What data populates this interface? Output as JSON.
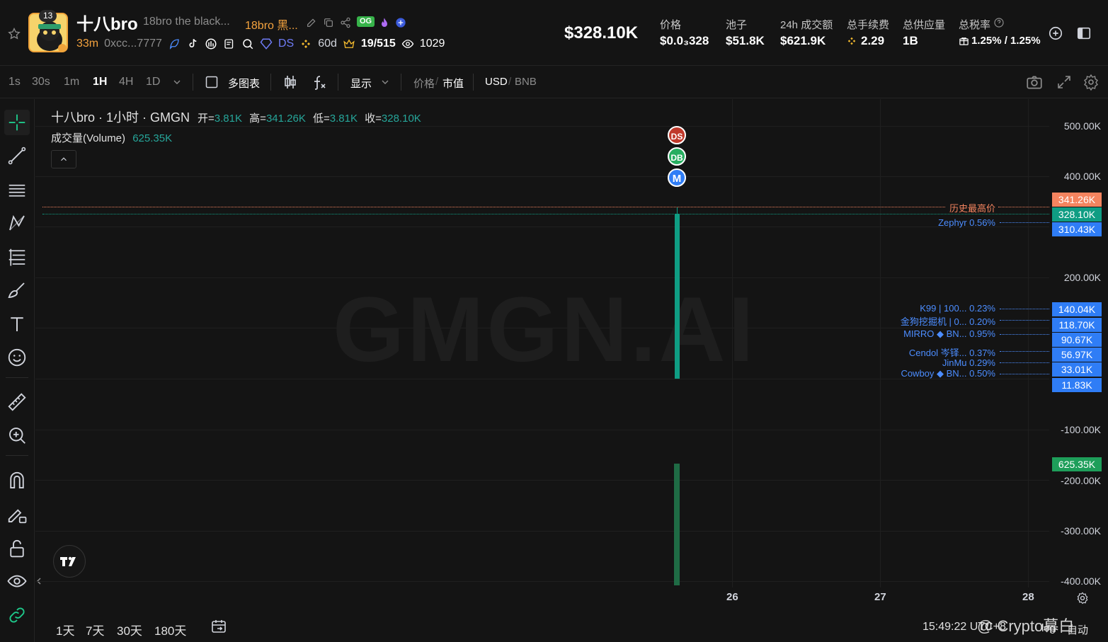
{
  "header": {
    "token_name": "十八bro",
    "token_full": "18bro the black...",
    "token_cn": "18bro 黑...",
    "avatar_badge": "13",
    "og_label": "OG",
    "age": "33m",
    "address": "0xcc...7777",
    "ds_label": "DS",
    "days": "60d",
    "holders": "19/515",
    "views": "1029",
    "market_cap": "$328.10K",
    "stats": [
      {
        "label": "价格",
        "value": "$0.0₃328"
      },
      {
        "label": "池子",
        "value": "$51.8K"
      },
      {
        "label": "24h 成交额",
        "value": "$621.9K"
      },
      {
        "label": "总手续费",
        "value": "2.29"
      },
      {
        "label": "总供应量",
        "value": "1B"
      },
      {
        "label": "总税率",
        "value": "1.25% / 1.25%"
      }
    ]
  },
  "toolbar": {
    "timeframes": [
      "1s",
      "30s",
      "1m",
      "1H",
      "4H",
      "1D"
    ],
    "active_timeframe": "1H",
    "multi_chart": "多图表",
    "display": "显示",
    "price_label": "价格",
    "mcap_label": "市值",
    "usd_label": "USD",
    "bnb_label": "BNB"
  },
  "chart": {
    "legend_title": "十八bro · 1小时 · GMGN",
    "open_lbl": "开=",
    "open": "3.81K",
    "high_lbl": "高=",
    "high": "341.26K",
    "low_lbl": "低=",
    "low": "3.81K",
    "close_lbl": "收=",
    "close": "328.10K",
    "volume_lbl": "成交量(Volume)",
    "volume": "625.35K",
    "watermark": "GMGN.AI",
    "ath_label": "历史最高价",
    "markers": [
      "DS",
      "DB",
      "M"
    ],
    "price_ticks": [
      "500.00K",
      "400.00K",
      "200.00K",
      "-100.00K",
      "-200.00K",
      "-300.00K",
      "-400.00K"
    ],
    "axis_labels": [
      {
        "text": "341.26K",
        "color": "#f4845f"
      },
      {
        "text": "328.10K",
        "color": "#0f9d83"
      },
      {
        "text": "310.43K",
        "color": "#2f7df6"
      },
      {
        "text": "140.04K",
        "color": "#2f7df6"
      },
      {
        "text": "118.70K",
        "color": "#2f7df6"
      },
      {
        "text": "90.67K",
        "color": "#2f7df6"
      },
      {
        "text": "56.97K",
        "color": "#2f7df6"
      },
      {
        "text": "33.01K",
        "color": "#2f7df6"
      },
      {
        "text": "11.83K",
        "color": "#2f7df6"
      },
      {
        "text": "625.35K",
        "color": "#1e9e5a"
      }
    ],
    "holder_lines": [
      "Zephyr 0.56%",
      "K99 | 100... 0.23%",
      "金狗挖掘机 | 0... 0.20%",
      "MIRRO ◆ BN... 0.95%",
      "Cendol 岑铎... 0.37%",
      "JinMu 0.29%",
      "Cowboy ◆ BN... 0.50%"
    ],
    "x_labels": [
      "26",
      "27",
      "28"
    ]
  },
  "bottom": {
    "ranges": [
      "1天",
      "7天",
      "30天",
      "180天"
    ],
    "clock": "15:49:22 UTC+8",
    "credit": "@ Crypto幕白",
    "log": "log",
    "auto": "自动"
  },
  "chart_data": {
    "type": "candlestick",
    "interval": "1H",
    "candles": [
      {
        "open": 3810,
        "high": 341260,
        "low": 3810,
        "close": 328100,
        "volume": 625350
      }
    ],
    "ylim": [
      -400000,
      500000
    ],
    "reference_lines": [
      {
        "name": "历史最高价",
        "value": 341260
      },
      {
        "name": "Zephyr 0.56%",
        "value": 310430
      },
      {
        "name": "K99 | 100... 0.23%",
        "value": 140040
      },
      {
        "name": "金狗挖掘机 | 0... 0.20%",
        "value": 118700
      },
      {
        "name": "MIRRO ◆ BN... 0.95%",
        "value": 90670
      },
      {
        "name": "Cendol 岑铎... 0.37%",
        "value": 56970
      },
      {
        "name": "JinMu 0.29%",
        "value": 33010
      },
      {
        "name": "Cowboy ◆ BN... 0.50%",
        "value": 11830
      }
    ],
    "x_ticks": [
      "26",
      "27",
      "28"
    ]
  }
}
